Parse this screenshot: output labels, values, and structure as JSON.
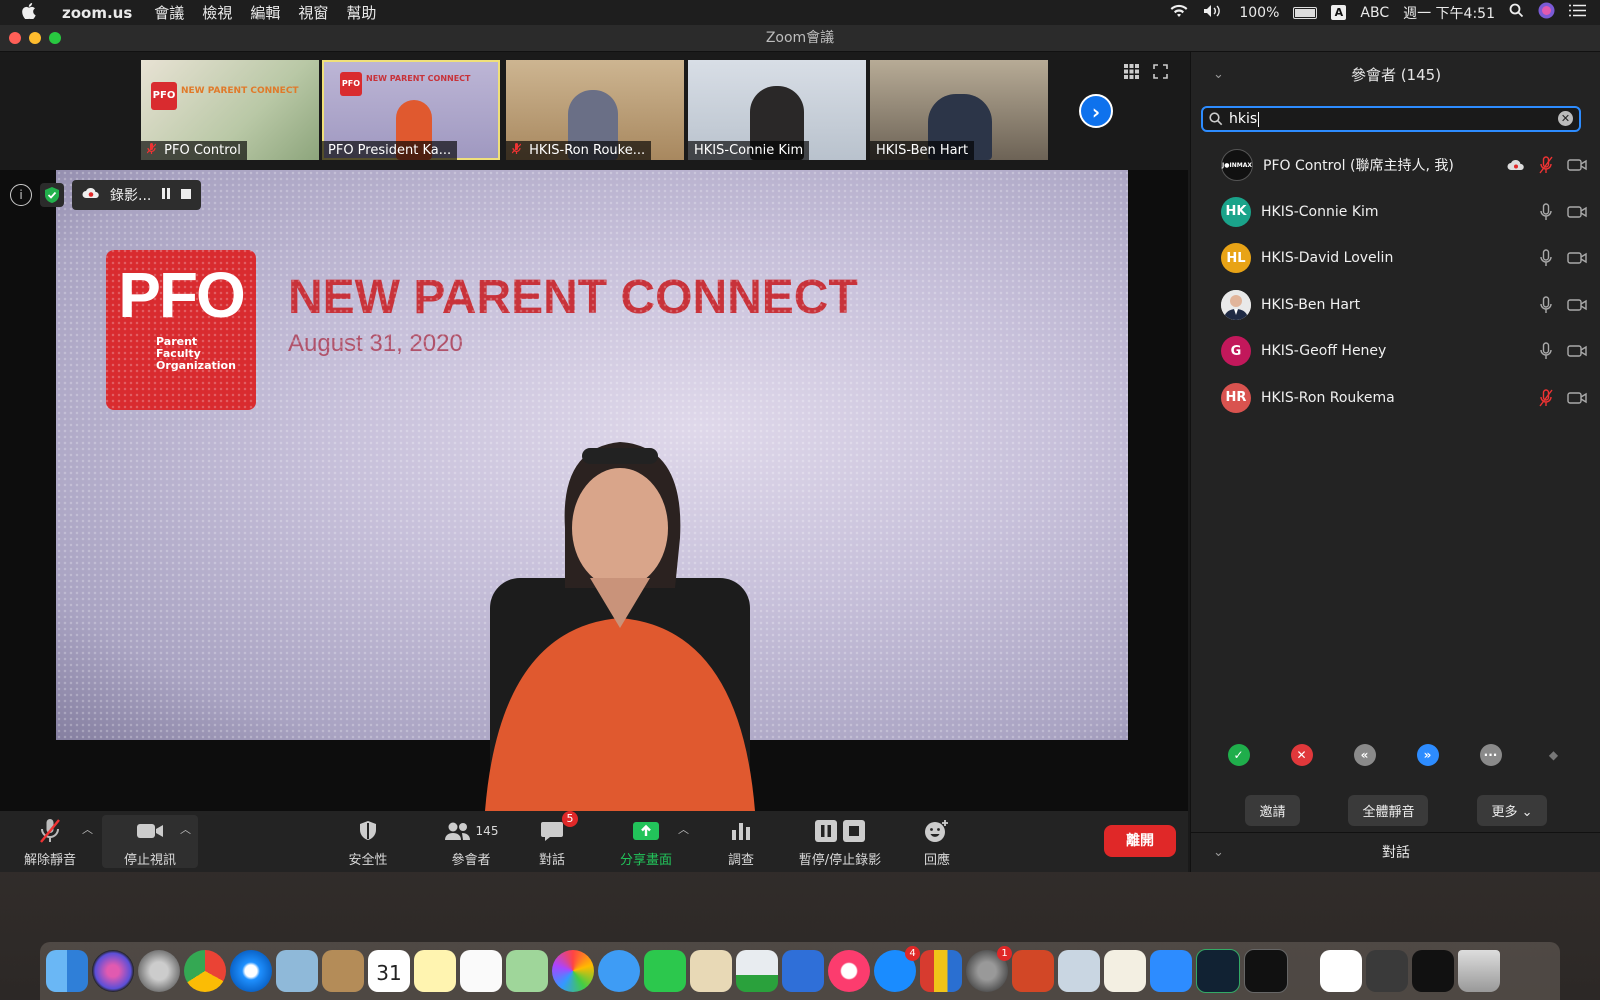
{
  "menubar": {
    "app": "zoom.us",
    "items": [
      "會議",
      "檢視",
      "編輯",
      "視窗",
      "幫助"
    ],
    "battery": "100%",
    "input_method": "ABC",
    "clock": "週一 下午4:51"
  },
  "window": {
    "title": "Zoom會議"
  },
  "thumbnails": [
    {
      "name": "PFO Control",
      "muted": true
    },
    {
      "name": "PFO President Ka...",
      "muted": false,
      "active": true
    },
    {
      "name": "HKIS-Ron Rouke...",
      "muted": true
    },
    {
      "name": "HKIS-Connie Kim",
      "muted": false
    },
    {
      "name": "HKIS-Ben Hart",
      "muted": false
    }
  ],
  "thumb_slide_title": "NEW PARENT CONNECT",
  "recording": {
    "label": "錄影..."
  },
  "slide": {
    "logo": "PFO",
    "logo_sub": [
      "Parent",
      "Faculty",
      "Organization"
    ],
    "title": "NEW PARENT CONNECT",
    "date": "August 31, 2020"
  },
  "toolbar": {
    "unmute": "解除靜音",
    "stop_video": "停止視訊",
    "security": "安全性",
    "participants": "參會者",
    "participants_count": "145",
    "chat": "對話",
    "chat_badge": "5",
    "share": "分享畫面",
    "polls": "調查",
    "record": "暫停/停止錄影",
    "reactions": "回應",
    "leave": "離開"
  },
  "panel": {
    "title": "參會者 (145)",
    "search_value": "hkis",
    "participants": [
      {
        "initials": "",
        "name": "PFO Control (聯席主持人, 我)",
        "color": "#111111",
        "mic_muted": true
      },
      {
        "initials": "HK",
        "name": "HKIS-Connie Kim",
        "color": "#1aa38a",
        "mic_muted": false
      },
      {
        "initials": "HL",
        "name": "HKIS-David Lovelin",
        "color": "#e8a316",
        "mic_muted": false
      },
      {
        "initials": "",
        "name": "HKIS-Ben Hart",
        "color": "#d9d9d9",
        "mic_muted": false
      },
      {
        "initials": "G",
        "name": "HKIS-Geoff Heney",
        "color": "#c2185b",
        "mic_muted": false
      },
      {
        "initials": "HR",
        "name": "HKIS-Ron Roukema",
        "color": "#d9534f",
        "mic_muted": true
      }
    ],
    "invite": "邀請",
    "mute_all": "全體靜音",
    "more": "更多",
    "chat_title": "對話"
  },
  "dock": {
    "calendar_day": "31",
    "badges": {
      "appstore": "4",
      "prefs": "1"
    }
  }
}
